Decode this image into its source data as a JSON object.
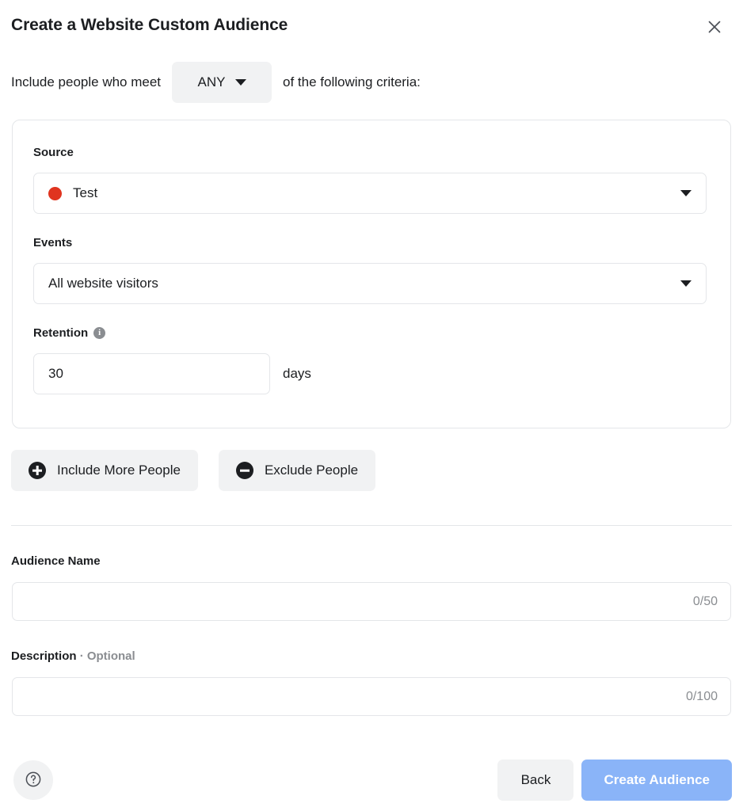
{
  "header": {
    "title": "Create a Website Custom Audience",
    "close_icon": "close-icon"
  },
  "criteria": {
    "prefix_text": "Include people who meet",
    "match_value": "ANY",
    "suffix_text": "of the following criteria:",
    "caret_icon": "chevron-down-icon"
  },
  "card": {
    "source": {
      "label": "Source",
      "value": "Test",
      "dot_color": "#e0341f",
      "caret_icon": "chevron-down-icon"
    },
    "events": {
      "label": "Events",
      "value": "All website visitors",
      "caret_icon": "chevron-down-icon"
    },
    "retention": {
      "label": "Retention",
      "info_icon": "info-icon",
      "value": "30",
      "unit": "days"
    }
  },
  "people_actions": [
    {
      "label": "Include More People",
      "icon": "plus-circle-icon"
    },
    {
      "label": "Exclude People",
      "icon": "minus-circle-icon"
    }
  ],
  "audience_name": {
    "label": "Audience Name",
    "value": "",
    "placeholder": "",
    "counter": "0/50"
  },
  "description": {
    "label": "Description",
    "optional_label": "· Optional",
    "value": "",
    "placeholder": "",
    "counter": "0/100"
  },
  "footer": {
    "help_icon": "help-circle-icon",
    "back_label": "Back",
    "create_label": "Create Audience",
    "create_color": "#8ab4f8"
  }
}
